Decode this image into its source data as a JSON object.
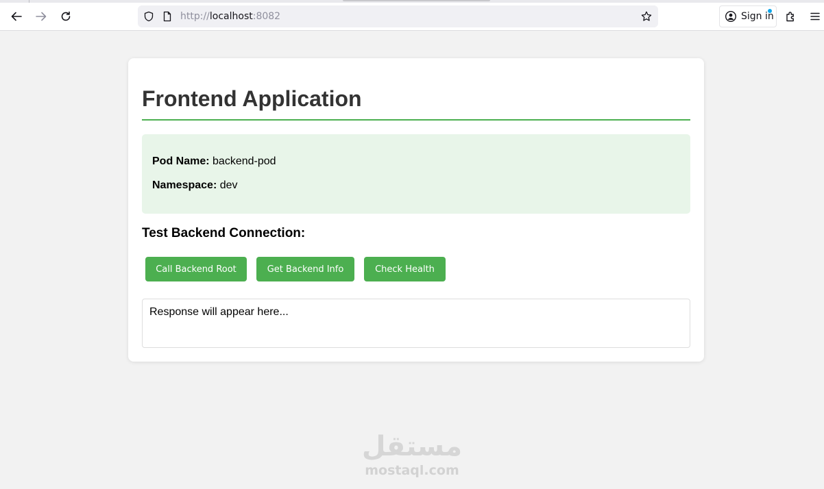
{
  "browser": {
    "url_scheme": "http://",
    "url_host": "localhost",
    "url_port": ":8082",
    "signin_label": "Sign in",
    "icons": {
      "back": "arrow-left-icon",
      "forward": "arrow-right-icon",
      "reload": "reload-icon",
      "shield": "shield-icon",
      "page": "page-icon",
      "bookmark": "star-icon",
      "account": "account-icon",
      "extensions": "puzzle-icon",
      "menu": "hamburger-menu-icon"
    }
  },
  "app": {
    "title": "Frontend Application",
    "pod_label": "Pod Name:",
    "pod_value": "backend-pod",
    "namespace_label": "Namespace:",
    "namespace_value": "dev",
    "section_title": "Test Backend Connection:",
    "buttons": {
      "root": "Call Backend Root",
      "info": "Get Backend Info",
      "health": "Check Health"
    },
    "response_placeholder": "Response will appear here...",
    "accent_color": "#4caf50",
    "info_bg_color": "#e8f5e9"
  },
  "watermark": {
    "logo": "مستقل",
    "text": "mostaql.com"
  }
}
